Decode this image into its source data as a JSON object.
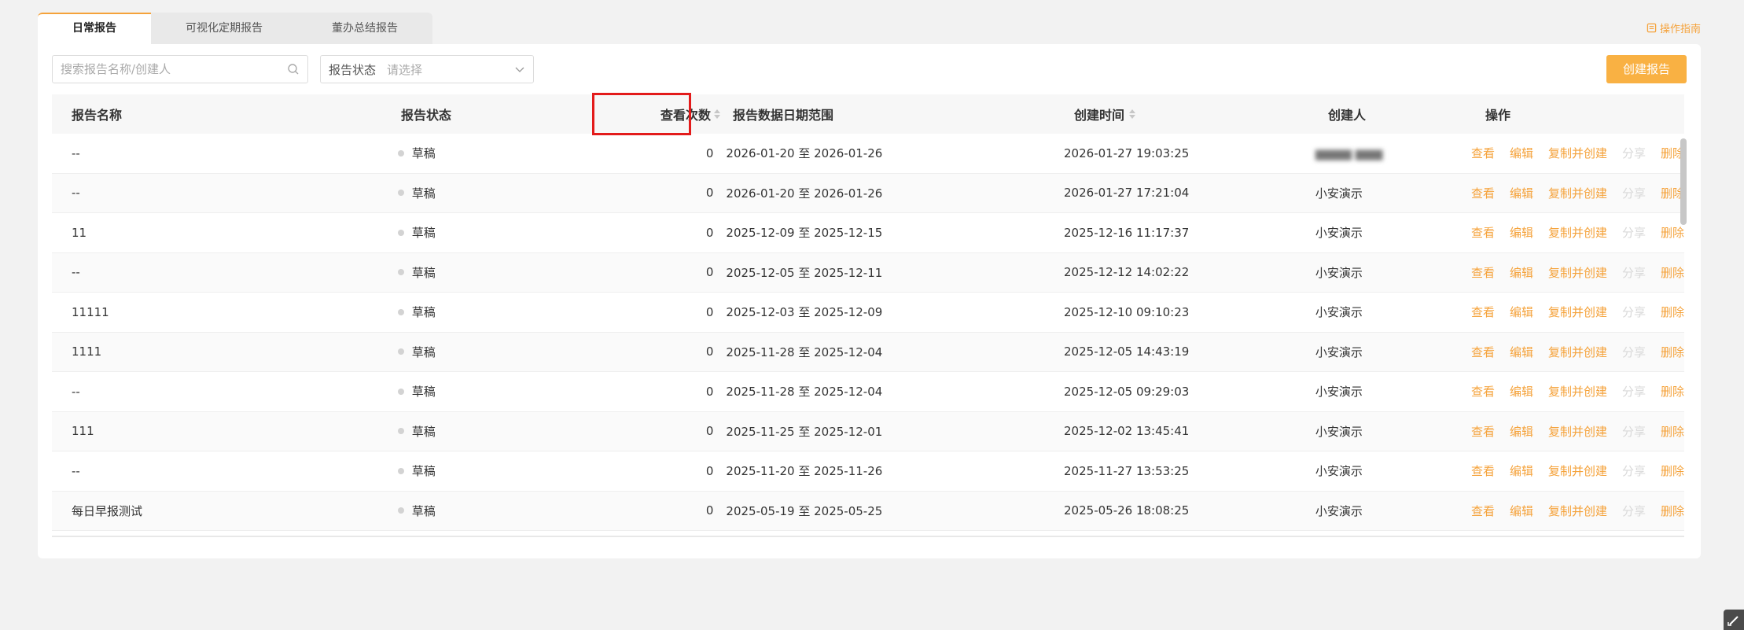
{
  "tabs": [
    {
      "label": "日常报告",
      "active": true
    },
    {
      "label": "可视化定期报告",
      "active": false
    },
    {
      "label": "董办总结报告",
      "active": false
    }
  ],
  "guide_label": "操作指南",
  "search": {
    "placeholder": "搜索报告名称/创建人"
  },
  "status_filter": {
    "label": "报告状态",
    "placeholder": "请选择"
  },
  "create_button": "创建报告",
  "table": {
    "headers": {
      "name": "报告名称",
      "status": "报告状态",
      "views": "查看次数",
      "range": "报告数据日期范围",
      "time": "创建时间",
      "creator": "创建人",
      "ops": "操作"
    },
    "op_labels": {
      "view": "查看",
      "edit": "编辑",
      "copy": "复制并创建",
      "share": "分享",
      "delete": "删除"
    },
    "rows": [
      {
        "name": "--",
        "status": "草稿",
        "views": "0",
        "range": "2026-01-20 至 2026-01-26",
        "time": "2026-01-27 19:03:25",
        "creator": "",
        "creator_blurred": true
      },
      {
        "name": "--",
        "status": "草稿",
        "views": "0",
        "range": "2026-01-20 至 2026-01-26",
        "time": "2026-01-27 17:21:04",
        "creator": "小安演示",
        "creator_blurred": false
      },
      {
        "name": "11",
        "status": "草稿",
        "views": "0",
        "range": "2025-12-09 至 2025-12-15",
        "time": "2025-12-16 11:17:37",
        "creator": "小安演示",
        "creator_blurred": false
      },
      {
        "name": "--",
        "status": "草稿",
        "views": "0",
        "range": "2025-12-05 至 2025-12-11",
        "time": "2025-12-12 14:02:22",
        "creator": "小安演示",
        "creator_blurred": false
      },
      {
        "name": "11111",
        "status": "草稿",
        "views": "0",
        "range": "2025-12-03 至 2025-12-09",
        "time": "2025-12-10 09:10:23",
        "creator": "小安演示",
        "creator_blurred": false
      },
      {
        "name": "1111",
        "status": "草稿",
        "views": "0",
        "range": "2025-11-28 至 2025-12-04",
        "time": "2025-12-05 14:43:19",
        "creator": "小安演示",
        "creator_blurred": false
      },
      {
        "name": "--",
        "status": "草稿",
        "views": "0",
        "range": "2025-11-28 至 2025-12-04",
        "time": "2025-12-05 09:29:03",
        "creator": "小安演示",
        "creator_blurred": false
      },
      {
        "name": "111",
        "status": "草稿",
        "views": "0",
        "range": "2025-11-25 至 2025-12-01",
        "time": "2025-12-02 13:45:41",
        "creator": "小安演示",
        "creator_blurred": false
      },
      {
        "name": "--",
        "status": "草稿",
        "views": "0",
        "range": "2025-11-20 至 2025-11-26",
        "time": "2025-11-27 13:53:25",
        "creator": "小安演示",
        "creator_blurred": false
      },
      {
        "name": "每日早报测试",
        "status": "草稿",
        "views": "0",
        "range": "2025-05-19 至 2025-05-25",
        "time": "2025-05-26 18:08:25",
        "creator": "小安演示",
        "creator_blurred": false
      }
    ]
  },
  "colors": {
    "accent": "#f5a23a",
    "button": "#f9b143",
    "highlight": "#e31b1b"
  }
}
